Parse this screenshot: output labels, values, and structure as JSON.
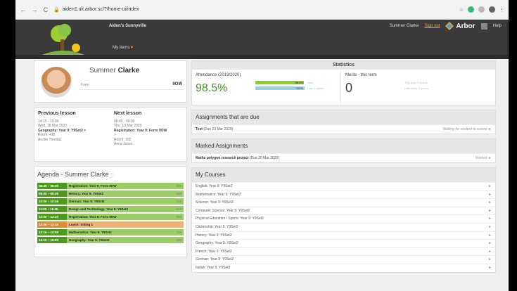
{
  "browser": {
    "url": "aiden1.uk.arbor.sc/?/home-ui/index",
    "back": "←",
    "forward": "→",
    "reload": "C"
  },
  "header": {
    "school": "Aiden's Sunnyville",
    "my_items": "My Items",
    "user": "Summer Clarke",
    "sign_out": "Sign out",
    "brand": "Arbor",
    "help": "Help"
  },
  "profile": {
    "first": "Summer",
    "last": "Clarke",
    "form_label": "Form",
    "form_value": "9OW"
  },
  "previous_lesson": {
    "title": "Previous lesson",
    "time": "14:15 - 15:00",
    "date": "Wed, 18 Mar 2020",
    "subject": "Geography: Year 9: Y9Set2 >",
    "room": "Room: 418",
    "teacher": "Archie Thomas"
  },
  "next_lesson": {
    "title": "Next lesson",
    "time": "08:45 - 09:00",
    "date": "Thu, 19 Mar 2020",
    "subject": "Registration: Year 9: Form 9OW",
    "extra": ">",
    "room": "Room: 302",
    "teacher": "Anna Jones"
  },
  "agenda": {
    "title": "Agenda - Summer Clarke",
    "marker": "○",
    "items": [
      {
        "time": "08:45 – 09:00",
        "desc": "Registration: Year 9: Form 9OW",
        "room": "302",
        "color": "green"
      },
      {
        "time": "09:00 – 09:45",
        "desc": "History: Year 9: Y9Set2",
        "room": "416",
        "color": "green"
      },
      {
        "time": "10:00 – 10:45",
        "desc": "German: Year 9: Y9Set2",
        "room": "315",
        "color": "green"
      },
      {
        "time": "11:00 – 11:45",
        "desc": "Design and Technology: Year 9: Y9Set2",
        "room": "613",
        "color": "green"
      },
      {
        "time": "13:00 – 13:10",
        "desc": "Registration: Year 9: Form 9OW",
        "room": "302",
        "color": "green"
      },
      {
        "time": "13:00 – 13:45",
        "desc": "Lunch: Sitting 1",
        "room": "",
        "color": "orange"
      },
      {
        "time": "13:15 – 14:00",
        "desc": "Mathematics: Year 9: Y9Set2",
        "room": "106",
        "color": "green"
      },
      {
        "time": "14:15 – 15:00",
        "desc": "Geography: Year 9: Y9Set2",
        "room": "418",
        "color": "green"
      }
    ]
  },
  "statistics": {
    "title": "Statistics",
    "attendance_label": "Attendance (2019/2020)",
    "attendance_value": "98.5%",
    "bar1_value": "98.5%",
    "bar1_desc": "Year",
    "bar1_fraction": 0.985,
    "bar2_value": "100%",
    "bar2_desc": "Last 4 weeks",
    "bar2_fraction": 1.0,
    "merits_label": "Merits - this term",
    "merits_value": "0",
    "merits_year": "This year: 0 points",
    "merits_week": "Last week: 0 points"
  },
  "assignments_due": {
    "title": "Assignments that are due",
    "items": [
      {
        "name": "Test",
        "due": "(Due 23 Mar 2020)",
        "status": "Waiting for student to submit ►"
      }
    ]
  },
  "marked_assignments": {
    "title": "Marked Assignments",
    "items": [
      {
        "name": "Maths polygon research project",
        "due": "(Due 20 Mar 2020)",
        "status": "Marked ►"
      }
    ]
  },
  "my_courses": {
    "title": "My Courses",
    "arrow": "►",
    "items": [
      "English: Year 9: Y9Set2",
      "Mathematics: Year 9: Y9Set2",
      "Science: Year 9: Y9Set2",
      "Computer Science: Year 9: Y9Set2",
      "Physical Education / Sports: Year 9: Y9Set2",
      "Citizenship: Year 9: Y9Set2",
      "History: Year 9: Y9Set2",
      "Geography: Year 9: Y9Set2",
      "French: Year 9: Y9Set2",
      "German: Year 9: Y9Set2",
      "Italian: Year 9: Y9Set2"
    ]
  },
  "colors": {
    "header_bg": "#3a3a3a",
    "accent_orange": "#f5a623",
    "attendance_green": "#3d9a1f",
    "bar_year": "#8bd12a",
    "bar_weeks": "#8fd3e6"
  }
}
